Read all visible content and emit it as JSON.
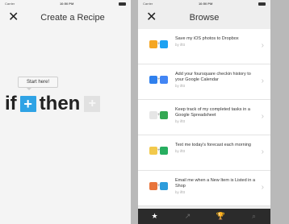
{
  "left": {
    "status": {
      "carrier": "Carrier",
      "time": "10:50 PM"
    },
    "title": "Create a Recipe",
    "close_glyph": "✕",
    "tooltip": "Start here!",
    "if_word": "if",
    "then_word": "then",
    "plus_glyph": "+"
  },
  "right": {
    "status": {
      "carrier": "Carrier",
      "time": "10:50 PM"
    },
    "title": "Browse",
    "close_glyph": "✕",
    "recipes": [
      {
        "title": "Save my iOS photos to Dropbox",
        "by": "by ifttt",
        "icon_a": "#f5a623",
        "icon_b": "#1da1f2"
      },
      {
        "title": "Add your foursquare checkin history to your Google Calendar",
        "by": "by ifttt",
        "icon_a": "#2f80ed",
        "icon_b": "#4285f4"
      },
      {
        "title": "Keep track of my completed tasks in a Google Spreadsheet",
        "by": "by ifttt",
        "icon_a": "#e6e6e6",
        "icon_b": "#34a853"
      },
      {
        "title": "Text me today's forecast each morning",
        "by": "by ifttt",
        "icon_a": "#f2c94c",
        "icon_b": "#27ae60"
      },
      {
        "title": "Email me when a New Item is Listed in a Shop",
        "by": "by ifttt",
        "icon_a": "#e8743b",
        "icon_b": "#2d9cdb"
      }
    ],
    "chevron": "›",
    "tabs": [
      {
        "name": "star-icon",
        "glyph": "★"
      },
      {
        "name": "chart-icon",
        "glyph": "↗"
      },
      {
        "name": "trophy-icon",
        "glyph": "🏆"
      },
      {
        "name": "search-icon",
        "glyph": "⌕"
      }
    ]
  }
}
